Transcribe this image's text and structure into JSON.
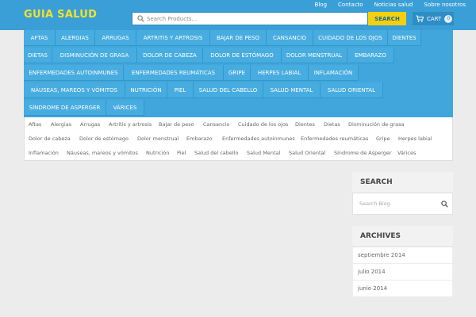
{
  "header": {
    "logo": "GUIA SALUD",
    "top_links": [
      "Blog",
      "Contacto",
      "Noticias salud",
      "Sobre nosotros"
    ],
    "search_placeholder": "Search Products...",
    "search_button": "SEARCH",
    "cart_label": "CART",
    "cart_count": "0"
  },
  "categories": {
    "rows": [
      [
        "AFTAS",
        "ALERGIAS",
        "ARRUGAS",
        "ARTRITIS Y ARTROSIS",
        "BAJAR DE PESO",
        "CANSANCIO",
        "CUIDADO DE LOS OJOS",
        "DIENTES"
      ],
      [
        "DIETAS",
        "DISMINUCIÓN DE GRASA",
        "DOLOR DE CABEZA",
        "DOLOR DE ESTÓMAGO",
        "DOLOR MENSTRUAL",
        "EMBARAZO"
      ],
      [
        "ENFERMEDADES AUTOINMUNES",
        "ENFERMEDADES REUMÁTICAS",
        "GRIPE",
        "HERPES LABIAL",
        "INFLAMACIÓN"
      ],
      [
        "NÁUSEAS, MAREOS Y VÓMITOS",
        "NUTRICIÓN",
        "PIEL",
        "SALUD DEL CABELLO",
        "SALUD MENTAL",
        "SALUD ORIENTAL"
      ],
      [
        "SÍNDROME DE ASPERGER",
        "VÁRICES"
      ]
    ]
  },
  "tags": {
    "rows": [
      [
        "Aftas",
        "Alergias",
        "Arrugas",
        "Artritis y artrosis",
        "Bajar de peso",
        "Cansancio",
        "Cuidado de los ojos",
        "Dientes",
        "Dietas",
        "Disminución de grasa"
      ],
      [
        "Dolor de cabeza",
        "Dolor de estómago",
        "Dolor menstrual",
        "Embarazo",
        "Enfermedades autoinmunes",
        "Enfermedades reumáticas",
        "Gripe",
        "Herpes labial"
      ],
      [
        "Inflamación",
        "Náuseas, mareos y vómitos",
        "Nutrición",
        "Piel",
        "Salud del cabello",
        "Salud Mental",
        "Salud Oriental",
        "Síndrome de Asperger",
        "Várices"
      ]
    ]
  },
  "sidebar": {
    "search_title": "SEARCH",
    "search_placeholder": "Search Blog",
    "archives_title": "ARCHIVES",
    "archives": [
      "septiembre 2014",
      "julio 2014",
      "junio 2014"
    ]
  },
  "colors": {
    "header_bg": "#3a9fd6",
    "logo": "#f3e12a",
    "search_button_bg": "#f4d00c",
    "category_bg": "#47acdf"
  }
}
